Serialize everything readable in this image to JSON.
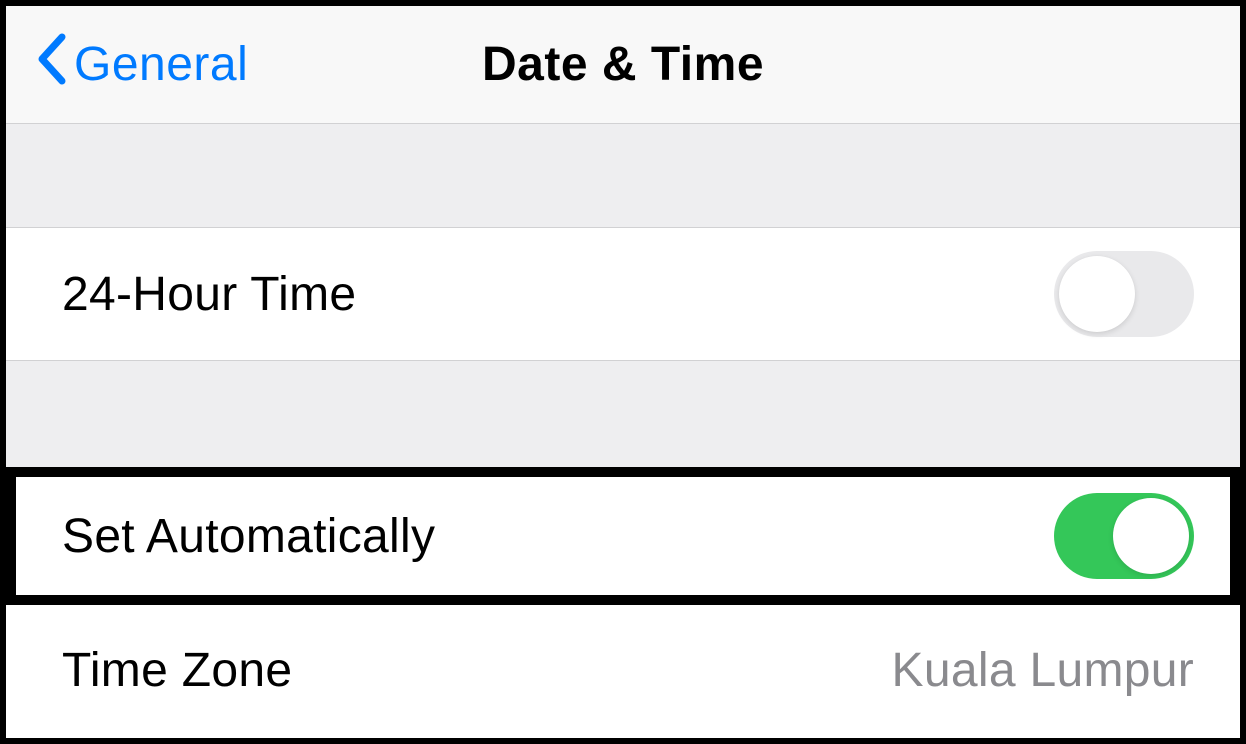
{
  "header": {
    "back_label": "General",
    "title": "Date & Time"
  },
  "rows": {
    "twenty_four_hour": {
      "label": "24-Hour Time",
      "enabled": false
    },
    "set_automatically": {
      "label": "Set Automatically",
      "enabled": true
    },
    "time_zone": {
      "label": "Time Zone",
      "value": "Kuala Lumpur"
    }
  }
}
